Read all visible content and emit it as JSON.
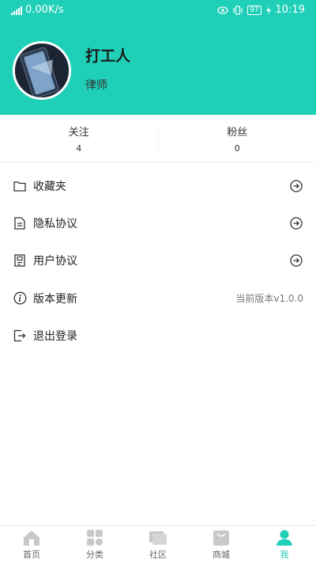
{
  "statusbar": {
    "net_speed": "0.00K/s",
    "battery": "97",
    "time": "10:19"
  },
  "profile": {
    "name": "打工人",
    "title": "律师"
  },
  "stats": {
    "follow_label": "关注",
    "follow_count": "4",
    "fans_label": "粉丝",
    "fans_count": "0"
  },
  "menu": {
    "items": [
      {
        "label": "收藏夹",
        "icon": "folder-icon"
      },
      {
        "label": "隐私协议",
        "icon": "document-icon"
      },
      {
        "label": "用户协议",
        "icon": "agreement-icon"
      },
      {
        "label": "版本更新",
        "icon": "info-icon",
        "right_text": "当前版本v1.0.0"
      },
      {
        "label": "退出登录",
        "icon": "logout-icon"
      }
    ]
  },
  "tabbar": {
    "tabs": [
      {
        "label": "首页",
        "icon": "home-icon"
      },
      {
        "label": "分类",
        "icon": "grid-icon"
      },
      {
        "label": "社区",
        "icon": "community-icon"
      },
      {
        "label": "商城",
        "icon": "shop-icon"
      },
      {
        "label": "我",
        "icon": "user-icon"
      }
    ],
    "active": "我"
  },
  "colors": {
    "accent": "#1fcfb7",
    "tab_inactive": "#c8c8c8"
  }
}
